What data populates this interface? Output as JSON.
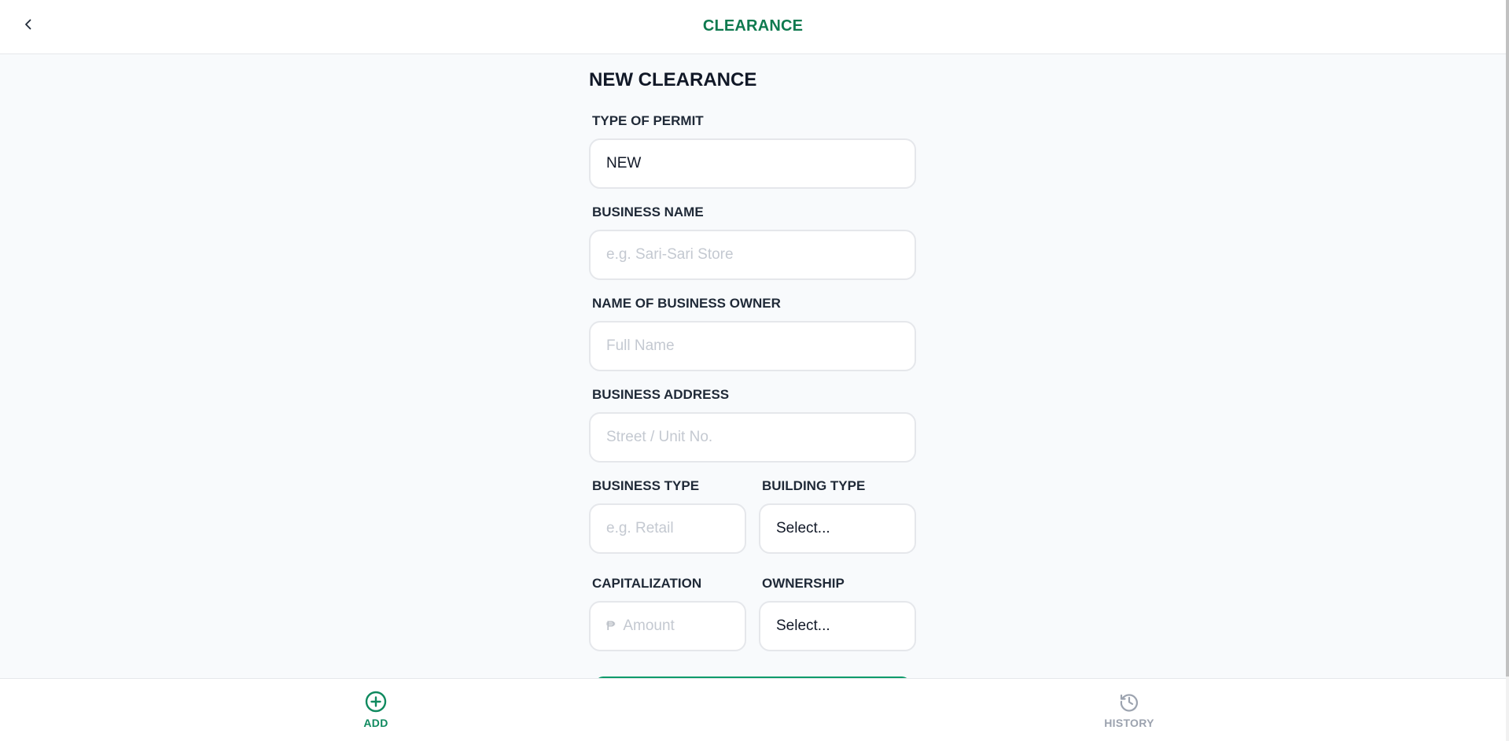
{
  "header": {
    "title": "CLEARANCE",
    "back_icon": "chevron-left-icon"
  },
  "form": {
    "title": "NEW CLEARANCE",
    "type_of_permit": {
      "label": "TYPE OF PERMIT",
      "value": "NEW"
    },
    "business_name": {
      "label": "BUSINESS NAME",
      "placeholder": "e.g. Sari-Sari Store"
    },
    "owner_name": {
      "label": "NAME OF BUSINESS OWNER",
      "placeholder": "Full Name"
    },
    "business_address": {
      "label": "BUSINESS ADDRESS",
      "placeholder": "Street / Unit No."
    },
    "business_type": {
      "label": "BUSINESS TYPE",
      "placeholder": "e.g. Retail"
    },
    "building_type": {
      "label": "BUILDING TYPE",
      "value": "Select..."
    },
    "capitalization": {
      "label": "CAPITALIZATION",
      "currency_symbol": "₱",
      "placeholder": "Amount"
    },
    "ownership": {
      "label": "OWNERSHIP",
      "value": "Select..."
    }
  },
  "bottom_nav": {
    "items": [
      {
        "label": "ADD",
        "icon": "plus-circle-icon",
        "active": true
      },
      {
        "label": "HISTORY",
        "icon": "history-icon",
        "active": false
      }
    ]
  },
  "colors": {
    "accent": "#0f8a5f",
    "inactive": "#9ca3af",
    "background": "#f8fafc"
  }
}
